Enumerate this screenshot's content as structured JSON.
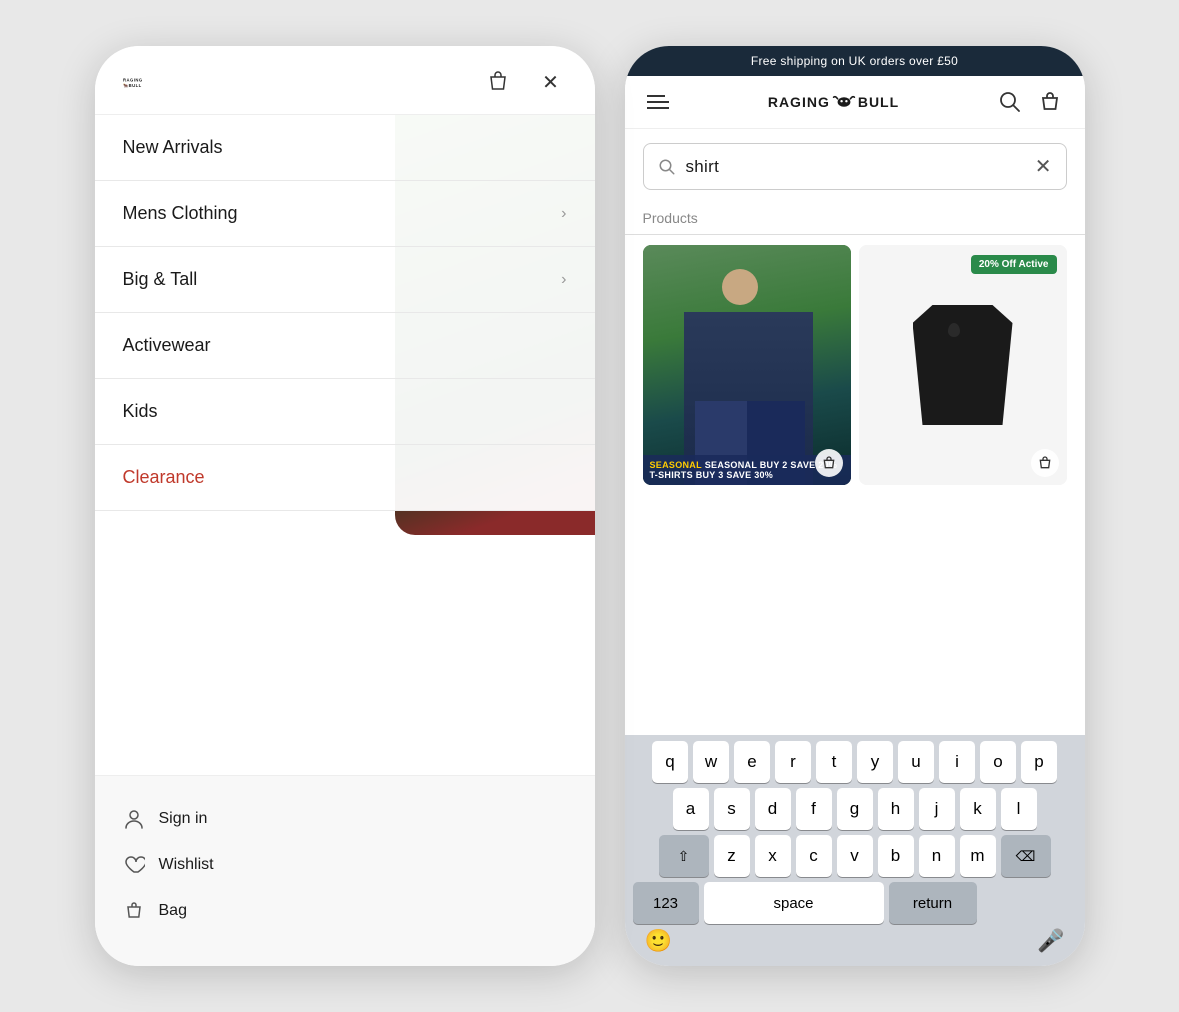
{
  "leftPhone": {
    "logo": "RAGING BULL",
    "nav": {
      "items": [
        {
          "label": "New Arrivals",
          "hasChevron": false,
          "style": "normal"
        },
        {
          "label": "Mens Clothing",
          "hasChevron": true,
          "style": "normal"
        },
        {
          "label": "Big & Tall",
          "hasChevron": true,
          "style": "normal"
        },
        {
          "label": "Activewear",
          "hasChevron": false,
          "style": "normal"
        },
        {
          "label": "Kids",
          "hasChevron": false,
          "style": "normal"
        },
        {
          "label": "Clearance",
          "hasChevron": false,
          "style": "clearance"
        }
      ]
    },
    "bottomNav": [
      {
        "icon": "person-icon",
        "label": "Sign in"
      },
      {
        "icon": "heart-icon",
        "label": "Wishlist"
      },
      {
        "icon": "bag-icon",
        "label": "Bag"
      }
    ]
  },
  "rightPhone": {
    "topBar": "Free shipping on UK orders over £50",
    "logo": "RAGING BULL",
    "search": {
      "query": "shirt",
      "placeholder": "shirt"
    },
    "productsLabel": "Products",
    "product1": {
      "promoBanner": "SEASONAL BUY 2 SAVE 20%",
      "promoSub": "T-SHIRTS BUY 3 SAVE 30%"
    },
    "product2": {
      "badge": "20% Off Active"
    },
    "keyboard": {
      "rows": [
        [
          "q",
          "w",
          "e",
          "r",
          "t",
          "y",
          "u",
          "i",
          "o",
          "p"
        ],
        [
          "a",
          "s",
          "d",
          "f",
          "g",
          "h",
          "j",
          "k",
          "l"
        ],
        [
          "z",
          "x",
          "c",
          "v",
          "b",
          "n",
          "m"
        ],
        [
          "123",
          "space",
          "return"
        ]
      ]
    }
  }
}
